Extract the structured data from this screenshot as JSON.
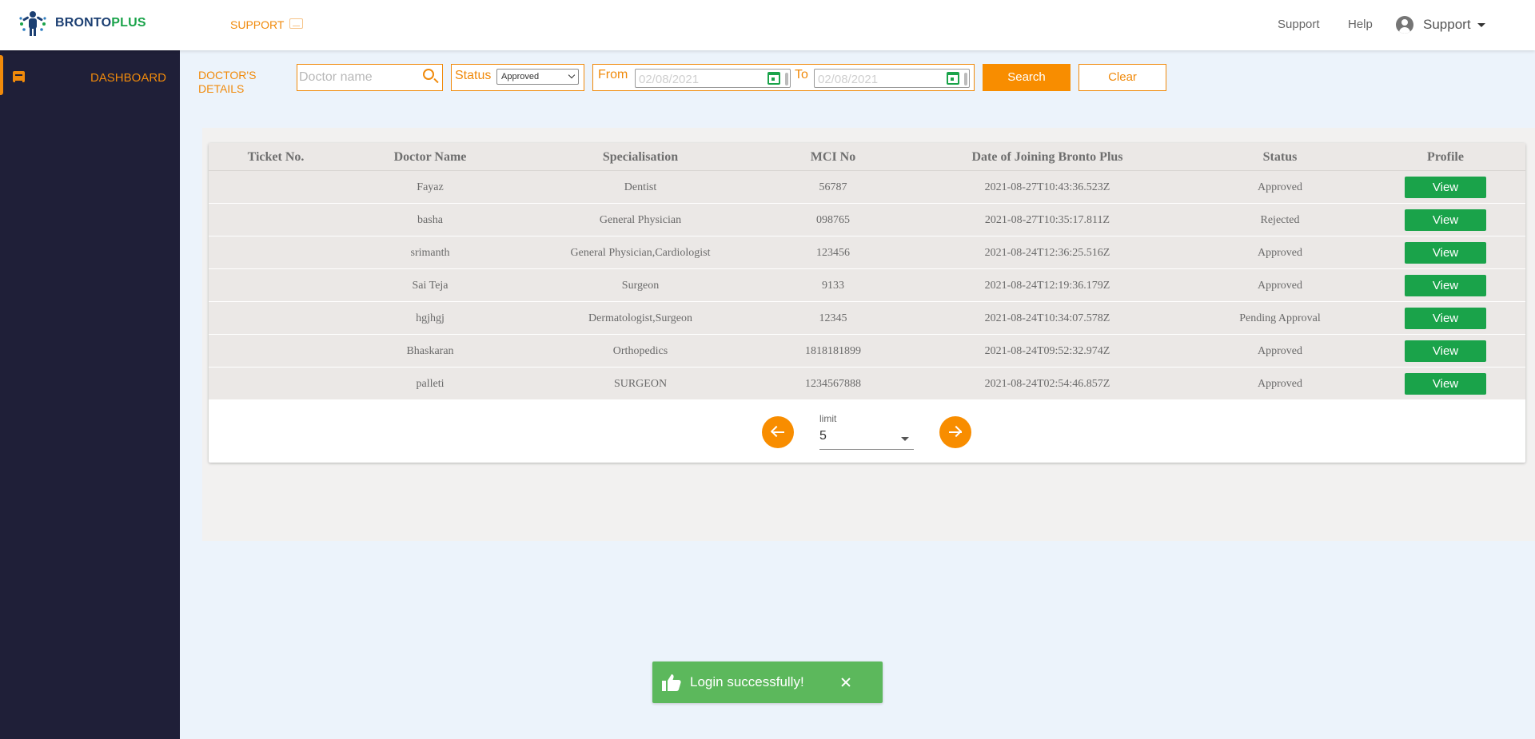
{
  "app": {
    "brand_part1": "BRONTO",
    "brand_part2": "PLUS",
    "brand_colors": {
      "navy": "#1c3f72",
      "green": "#1aa34a"
    }
  },
  "header": {
    "section_label": "SUPPORT",
    "links": {
      "support": "Support",
      "help": "Help"
    },
    "user_name": "Support"
  },
  "sidebar": {
    "items": [
      {
        "label": "DASHBOARD",
        "icon": "dashboard-icon",
        "active": true
      }
    ]
  },
  "filters": {
    "page_title_line1": "DOCTOR'S",
    "page_title_line2": "DETAILS",
    "doctor_placeholder": "Doctor name",
    "doctor_value": "",
    "status_label": "Status",
    "status_selected": "Approved",
    "from_label": "From",
    "from_value": "02/08/2021",
    "to_label": "To",
    "to_value": "02/08/2021",
    "search_label": "Search",
    "clear_label": "Clear",
    "accent_color": "#f08a0b"
  },
  "table": {
    "columns": [
      "Ticket No.",
      "Doctor Name",
      "Specialisation",
      "MCI No",
      "Date of Joining Bronto Plus",
      "Status",
      "Profile"
    ],
    "rows": [
      {
        "ticket": "",
        "name": "Fayaz",
        "specialisation": "Dentist",
        "mci": "56787",
        "joined": "2021-08-27T10:43:36.523Z",
        "status": "Approved",
        "profile": "View"
      },
      {
        "ticket": "",
        "name": "basha",
        "specialisation": "General Physician",
        "mci": "098765",
        "joined": "2021-08-27T10:35:17.811Z",
        "status": "Rejected",
        "profile": "View"
      },
      {
        "ticket": "",
        "name": "srimanth",
        "specialisation": "General Physician,Cardiologist",
        "mci": "123456",
        "joined": "2021-08-24T12:36:25.516Z",
        "status": "Approved",
        "profile": "View"
      },
      {
        "ticket": "",
        "name": "Sai Teja",
        "specialisation": "Surgeon",
        "mci": "9133",
        "joined": "2021-08-24T12:19:36.179Z",
        "status": "Approved",
        "profile": "View"
      },
      {
        "ticket": "",
        "name": "hgjhgj",
        "specialisation": "Dermatologist,Surgeon",
        "mci": "12345",
        "joined": "2021-08-24T10:34:07.578Z",
        "status": "Pending Approval",
        "profile": "View"
      },
      {
        "ticket": "",
        "name": "Bhaskaran",
        "specialisation": "Orthopedics",
        "mci": "1818181899",
        "joined": "2021-08-24T09:52:32.974Z",
        "status": "Approved",
        "profile": "View"
      },
      {
        "ticket": "",
        "name": "palleti",
        "specialisation": "SURGEON",
        "mci": "1234567888",
        "joined": "2021-08-24T02:54:46.857Z",
        "status": "Approved",
        "profile": "View"
      }
    ]
  },
  "pagination": {
    "limit_label": "limit",
    "limit_value": "5"
  },
  "toast": {
    "message": "Login successfully!",
    "icon": "thumbs-up-icon",
    "color": "#5cb85c"
  }
}
